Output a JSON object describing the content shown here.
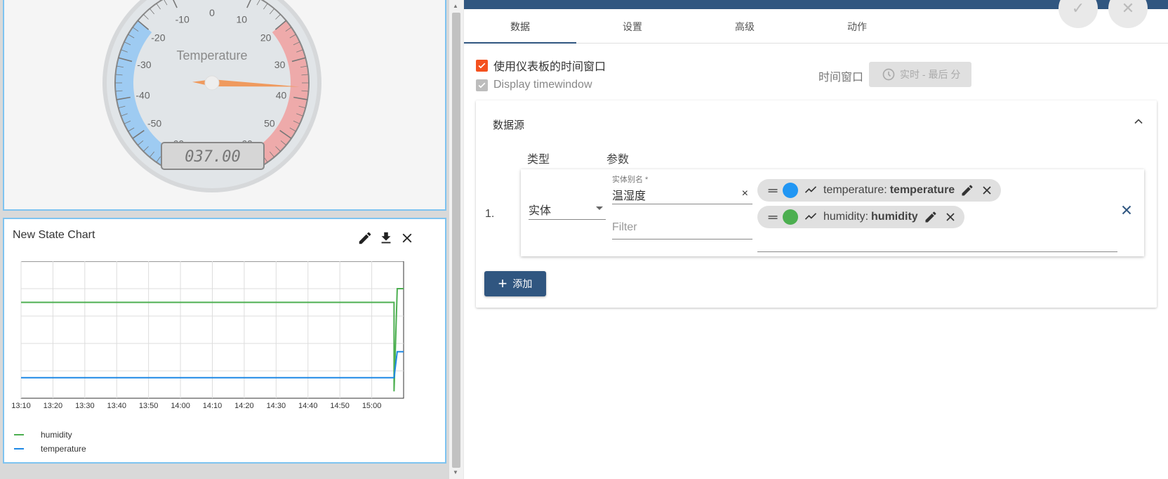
{
  "gauge": {
    "title": "Temperature",
    "value": 37.0,
    "display": "037.00",
    "min": -60,
    "max": 60,
    "ticks": [
      "-60",
      "-50",
      "-40",
      "-30",
      "-20",
      "-10",
      "0",
      "10",
      "20",
      "30",
      "40",
      "50",
      "60"
    ],
    "colors": {
      "low": "#9ecbf2",
      "high": "#eeaaaa",
      "needle": "#ef9a5e",
      "face": "#e1e5e8"
    }
  },
  "state_chart": {
    "title": "New State Chart",
    "actions": [
      "edit-icon",
      "download-icon",
      "close-icon"
    ],
    "legend": [
      {
        "name": "humidity",
        "color": "#4caf50"
      },
      {
        "name": "temperature",
        "color": "#1e88e5"
      }
    ]
  },
  "chart_data": {
    "type": "line",
    "x": [
      "13:10",
      "13:20",
      "13:30",
      "13:40",
      "13:50",
      "14:00",
      "14:10",
      "14:20",
      "14:30",
      "14:40",
      "14:50",
      "15:00"
    ],
    "series": [
      {
        "name": "humidity",
        "color": "#4caf50",
        "points": [
          [
            "13:10",
            0.7
          ],
          [
            "15:07",
            0.7
          ],
          [
            "15:07",
            0.05
          ],
          [
            "15:08",
            0.8
          ],
          [
            "15:10",
            0.8
          ]
        ]
      },
      {
        "name": "temperature",
        "color": "#1e88e5",
        "points": [
          [
            "13:10",
            0.15
          ],
          [
            "15:07",
            0.15
          ],
          [
            "15:08",
            0.34
          ],
          [
            "15:10",
            0.34
          ]
        ]
      }
    ],
    "grid": true,
    "legend_position": "bottom-left"
  },
  "panel": {
    "tabs": [
      "数据",
      "设置",
      "高级",
      "动作"
    ],
    "active_tab": "数据",
    "use_dashboard_timewindow": "使用仪表板的时间窗口",
    "display_timewindow": "Display timewindow",
    "timewindow_label": "时间窗口",
    "timewindow_value": "实时 - 最后 分",
    "datasource_title": "数据源",
    "col_type": "类型",
    "col_params": "参数",
    "row_index": "1.",
    "type_value": "实体",
    "alias_label": "实体别名 *",
    "alias_value": "温湿度",
    "alias_clear": "×",
    "filter_placeholder": "Filter",
    "keys": [
      {
        "label": "temperature:",
        "value": "temperature",
        "color": "#2196f3"
      },
      {
        "label": "humidity:",
        "value": "humidity",
        "color": "#4caf50"
      }
    ],
    "add_label": "添加",
    "colors": {
      "primary": "#305680",
      "checkbox_on": "#f4511e",
      "checkbox_disabled": "#bdbdbd"
    }
  }
}
